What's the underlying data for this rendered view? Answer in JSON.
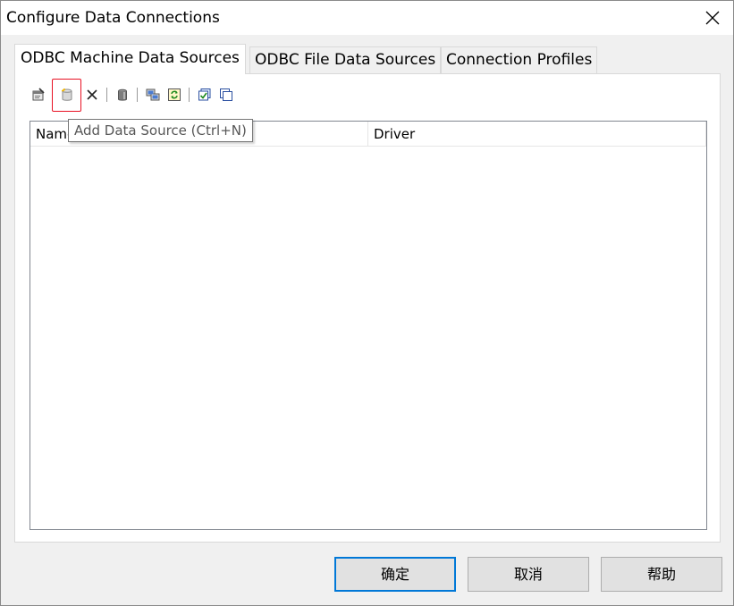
{
  "window": {
    "title": "Configure Data Connections"
  },
  "tabs": [
    {
      "label": "ODBC Machine Data Sources",
      "active": true
    },
    {
      "label": "ODBC File Data Sources",
      "active": false
    },
    {
      "label": "Connection Profiles",
      "active": false
    }
  ],
  "toolbar": {
    "buttons": [
      {
        "icon": "properties-icon"
      },
      {
        "icon": "add-data-source-icon"
      },
      {
        "icon": "delete-icon"
      },
      {
        "icon": "database-icon"
      },
      {
        "icon": "test-connection-icon"
      },
      {
        "icon": "refresh-icon"
      },
      {
        "icon": "select-all-icon"
      },
      {
        "icon": "copy-icon"
      }
    ]
  },
  "tooltip": {
    "text": "Add Data Source (Ctrl+N)"
  },
  "list": {
    "columns": [
      "Name",
      "Driver"
    ],
    "rows": []
  },
  "buttons": {
    "ok": "确定",
    "cancel": "取消",
    "help": "帮助"
  },
  "colors": {
    "accent": "#0078d7",
    "highlight": "#e81123",
    "face": "#f0f0f0"
  }
}
